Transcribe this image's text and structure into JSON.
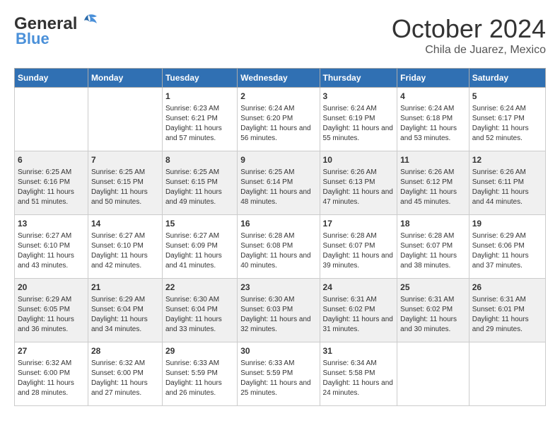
{
  "header": {
    "logo_line1": "General",
    "logo_line2": "Blue",
    "month": "October 2024",
    "location": "Chila de Juarez, Mexico"
  },
  "weekdays": [
    "Sunday",
    "Monday",
    "Tuesday",
    "Wednesday",
    "Thursday",
    "Friday",
    "Saturday"
  ],
  "weeks": [
    [
      {
        "day": "",
        "info": ""
      },
      {
        "day": "",
        "info": ""
      },
      {
        "day": "1",
        "info": "Sunrise: 6:23 AM\nSunset: 6:21 PM\nDaylight: 11 hours and 57 minutes."
      },
      {
        "day": "2",
        "info": "Sunrise: 6:24 AM\nSunset: 6:20 PM\nDaylight: 11 hours and 56 minutes."
      },
      {
        "day": "3",
        "info": "Sunrise: 6:24 AM\nSunset: 6:19 PM\nDaylight: 11 hours and 55 minutes."
      },
      {
        "day": "4",
        "info": "Sunrise: 6:24 AM\nSunset: 6:18 PM\nDaylight: 11 hours and 53 minutes."
      },
      {
        "day": "5",
        "info": "Sunrise: 6:24 AM\nSunset: 6:17 PM\nDaylight: 11 hours and 52 minutes."
      }
    ],
    [
      {
        "day": "6",
        "info": "Sunrise: 6:25 AM\nSunset: 6:16 PM\nDaylight: 11 hours and 51 minutes."
      },
      {
        "day": "7",
        "info": "Sunrise: 6:25 AM\nSunset: 6:15 PM\nDaylight: 11 hours and 50 minutes."
      },
      {
        "day": "8",
        "info": "Sunrise: 6:25 AM\nSunset: 6:15 PM\nDaylight: 11 hours and 49 minutes."
      },
      {
        "day": "9",
        "info": "Sunrise: 6:25 AM\nSunset: 6:14 PM\nDaylight: 11 hours and 48 minutes."
      },
      {
        "day": "10",
        "info": "Sunrise: 6:26 AM\nSunset: 6:13 PM\nDaylight: 11 hours and 47 minutes."
      },
      {
        "day": "11",
        "info": "Sunrise: 6:26 AM\nSunset: 6:12 PM\nDaylight: 11 hours and 45 minutes."
      },
      {
        "day": "12",
        "info": "Sunrise: 6:26 AM\nSunset: 6:11 PM\nDaylight: 11 hours and 44 minutes."
      }
    ],
    [
      {
        "day": "13",
        "info": "Sunrise: 6:27 AM\nSunset: 6:10 PM\nDaylight: 11 hours and 43 minutes."
      },
      {
        "day": "14",
        "info": "Sunrise: 6:27 AM\nSunset: 6:10 PM\nDaylight: 11 hours and 42 minutes."
      },
      {
        "day": "15",
        "info": "Sunrise: 6:27 AM\nSunset: 6:09 PM\nDaylight: 11 hours and 41 minutes."
      },
      {
        "day": "16",
        "info": "Sunrise: 6:28 AM\nSunset: 6:08 PM\nDaylight: 11 hours and 40 minutes."
      },
      {
        "day": "17",
        "info": "Sunrise: 6:28 AM\nSunset: 6:07 PM\nDaylight: 11 hours and 39 minutes."
      },
      {
        "day": "18",
        "info": "Sunrise: 6:28 AM\nSunset: 6:07 PM\nDaylight: 11 hours and 38 minutes."
      },
      {
        "day": "19",
        "info": "Sunrise: 6:29 AM\nSunset: 6:06 PM\nDaylight: 11 hours and 37 minutes."
      }
    ],
    [
      {
        "day": "20",
        "info": "Sunrise: 6:29 AM\nSunset: 6:05 PM\nDaylight: 11 hours and 36 minutes."
      },
      {
        "day": "21",
        "info": "Sunrise: 6:29 AM\nSunset: 6:04 PM\nDaylight: 11 hours and 34 minutes."
      },
      {
        "day": "22",
        "info": "Sunrise: 6:30 AM\nSunset: 6:04 PM\nDaylight: 11 hours and 33 minutes."
      },
      {
        "day": "23",
        "info": "Sunrise: 6:30 AM\nSunset: 6:03 PM\nDaylight: 11 hours and 32 minutes."
      },
      {
        "day": "24",
        "info": "Sunrise: 6:31 AM\nSunset: 6:02 PM\nDaylight: 11 hours and 31 minutes."
      },
      {
        "day": "25",
        "info": "Sunrise: 6:31 AM\nSunset: 6:02 PM\nDaylight: 11 hours and 30 minutes."
      },
      {
        "day": "26",
        "info": "Sunrise: 6:31 AM\nSunset: 6:01 PM\nDaylight: 11 hours and 29 minutes."
      }
    ],
    [
      {
        "day": "27",
        "info": "Sunrise: 6:32 AM\nSunset: 6:00 PM\nDaylight: 11 hours and 28 minutes."
      },
      {
        "day": "28",
        "info": "Sunrise: 6:32 AM\nSunset: 6:00 PM\nDaylight: 11 hours and 27 minutes."
      },
      {
        "day": "29",
        "info": "Sunrise: 6:33 AM\nSunset: 5:59 PM\nDaylight: 11 hours and 26 minutes."
      },
      {
        "day": "30",
        "info": "Sunrise: 6:33 AM\nSunset: 5:59 PM\nDaylight: 11 hours and 25 minutes."
      },
      {
        "day": "31",
        "info": "Sunrise: 6:34 AM\nSunset: 5:58 PM\nDaylight: 11 hours and 24 minutes."
      },
      {
        "day": "",
        "info": ""
      },
      {
        "day": "",
        "info": ""
      }
    ]
  ]
}
